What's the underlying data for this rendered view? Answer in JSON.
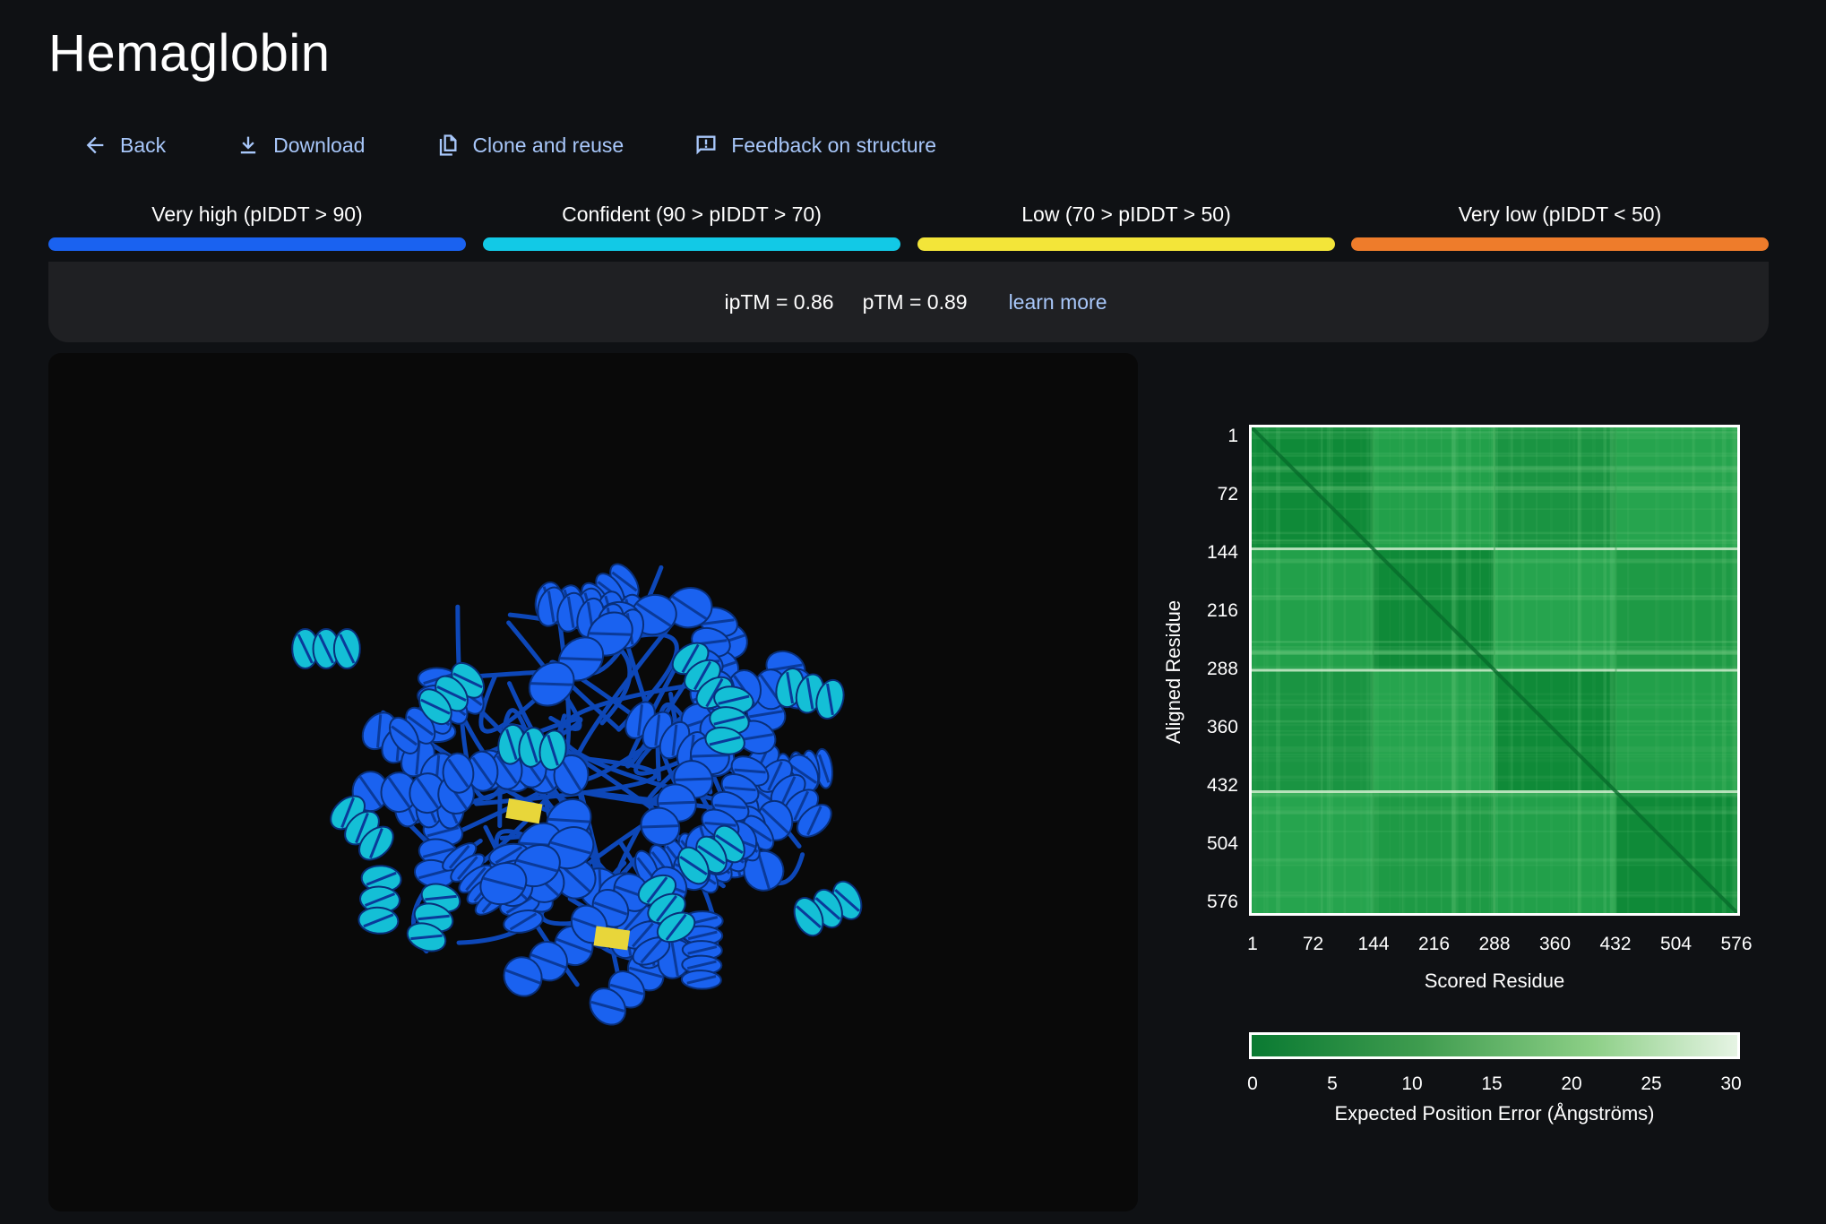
{
  "page": {
    "title": "Hemaglobin"
  },
  "toolbar": {
    "back_label": "Back",
    "download_label": "Download",
    "clone_label": "Clone and reuse",
    "feedback_label": "Feedback on structure"
  },
  "legend": [
    {
      "label": "Very high (pIDDT > 90)",
      "color": "#1a62f0"
    },
    {
      "label": "Confident (90 > pIDDT > 70)",
      "color": "#12c9e6"
    },
    {
      "label": "Low (70 > pIDDT > 50)",
      "color": "#f3e539"
    },
    {
      "label": "Very low (pIDDT < 50)",
      "color": "#ee7c2b"
    }
  ],
  "metrics": {
    "iptm": "ipTM = 0.86",
    "ptm": "pTM = 0.89",
    "learn_more": "learn more"
  },
  "structure_viewer": {
    "colors": {
      "very_high": "#1a62f0",
      "confident": "#14bfd6",
      "low": "#e8d63a"
    }
  },
  "pae_plot": {
    "y_ticks": [
      "1",
      "72",
      "144",
      "216",
      "288",
      "360",
      "432",
      "504",
      "576"
    ],
    "x_ticks": [
      "1",
      "72",
      "144",
      "216",
      "288",
      "360",
      "432",
      "504",
      "576"
    ],
    "y_label": "Aligned Residue",
    "x_label": "Scored Residue",
    "colorbar_ticks": [
      "0",
      "5",
      "10",
      "15",
      "20",
      "25",
      "30"
    ],
    "colorbar_label": "Expected Position Error (Ångströms)",
    "chains": 4,
    "colors": {
      "low_error": "#0a7a32",
      "high_error": "#e6f4e4",
      "map_base": "#179440"
    }
  }
}
